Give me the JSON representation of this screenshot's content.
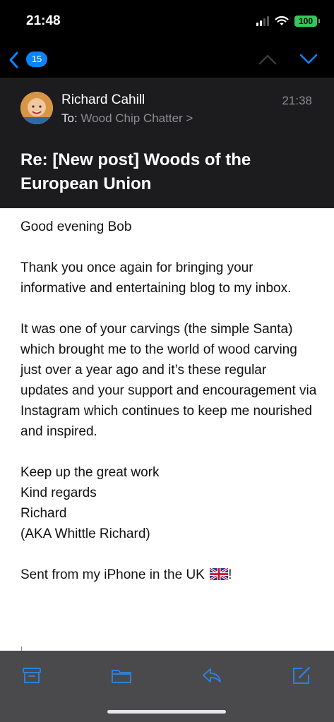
{
  "status_bar": {
    "time": "21:48",
    "battery": "100",
    "icons": [
      "signal-icon",
      "wifi-icon",
      "battery-icon"
    ]
  },
  "nav": {
    "back_count": "15",
    "icons": [
      "back-chevron-icon",
      "chevron-up-icon",
      "chevron-down-icon"
    ]
  },
  "header": {
    "sender": "Richard Cahill",
    "time": "21:38",
    "to_label": "To:",
    "recipient": "Wood Chip Chatter >",
    "subject": "Re: [New post] Woods of the European Union"
  },
  "body": {
    "greeting": "Good evening Bob",
    "para1": "Thank you once again for bringing your informative and entertaining blog to my inbox.",
    "para2": "It was one of your carvings (the simple Santa) which brought me to the world of wood carving just over a year ago and it’s these regular updates and your support and encouragement via Instagram which continues to keep me nourished and inspired.",
    "closing1": "Keep up the great work",
    "closing2": "Kind regards",
    "closing3": "Richard",
    "closing4": "(AKA Whittle Richard)",
    "signature": "Sent from my iPhone in the UK",
    "signature_end": "!"
  },
  "toolbar": {
    "icons": [
      "archive-icon",
      "folder-icon",
      "reply-icon",
      "compose-icon"
    ]
  },
  "colors": {
    "accent": "#0a84ff",
    "header_bg": "#1c1c1e",
    "toolbar_bg": "#4a4a4c",
    "battery": "#34c759"
  }
}
